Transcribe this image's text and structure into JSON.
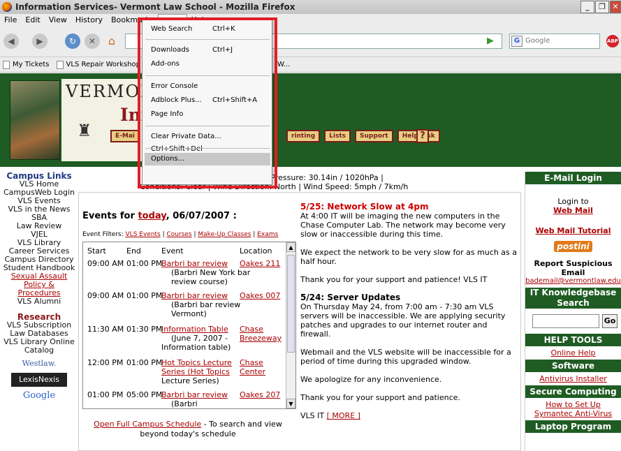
{
  "window": {
    "title": "Information Services- Vermont Law School - Mozilla Firefox"
  },
  "menubar": {
    "items": [
      "File",
      "Edit",
      "View",
      "History",
      "Bookmarks",
      "Tools",
      "Help"
    ]
  },
  "navbar": {
    "search_placeholder": "Google",
    "abp": "ABP"
  },
  "bookmarks": [
    "My Tickets",
    "VLS Repair Workshop",
    "W..."
  ],
  "banner": {
    "title": "VERMONT",
    "subtitle": "Inf",
    "buttons": [
      "E-Mai",
      "rinting",
      "Lists",
      "Support",
      "Helpdesk"
    ],
    "help": "?"
  },
  "tools_menu": {
    "web_search": "Web Search",
    "web_search_sc": "Ctrl+K",
    "downloads": "Downloads",
    "downloads_sc": "Ctrl+J",
    "addons": "Add-ons",
    "error_console": "Error Console",
    "adblock": "Adblock Plus...",
    "adblock_sc": "Ctrl+Shift+A",
    "page_info": "Page Info",
    "clear_private": "Clear Private Data... Ctrl+Shift+Del",
    "options": "Options..."
  },
  "left_nav": {
    "campus_head": "Campus Links",
    "campus_links": [
      "VLS Home",
      "CampusWeb Login",
      "VLS Events",
      "VLS in the News",
      "SBA",
      "Law Review",
      "VJEL",
      "VLS Library",
      "Career Services",
      "Campus Directory",
      "Student Handbook"
    ],
    "red_links": [
      "Sexual Assault",
      "Policy &",
      "Procedures"
    ],
    "alumni": "VLS Alumni",
    "research_head": "Research",
    "research_links": [
      "VLS Subscription",
      "Law Databases",
      "VLS Library Online",
      "Catalog"
    ],
    "westlaw": "Westlaw.",
    "lexis": "LexisNexis",
    "google": "Google"
  },
  "weather": {
    "line1": "nidity: 53% | Pressure: 30.14in / 1020hPa |",
    "line2": "Conditions: Clear | Wind Direction: North | Wind Speed: 5mph / 7km/h"
  },
  "events": {
    "title_prefix": "Events for",
    "title_link": "today",
    "title_suffix": ", 06/07/2007 :",
    "filters_label": "Event Filters:",
    "filters": [
      "VLS Events",
      "Courses",
      "Make-Up Classes",
      "Exams"
    ],
    "columns": [
      "Start",
      "End",
      "Event",
      "Location"
    ],
    "rows": [
      {
        "start": "09:00 AM",
        "end": "01:00 PM",
        "event": "Barbri bar review",
        "desc1": "(Barbri New York bar",
        "desc2": "review course)",
        "loc1": "Oakes 211",
        "loc2": ""
      },
      {
        "start": "09:00 AM",
        "end": "01:00 PM",
        "event": "Barbri bar review",
        "desc1": "(Barbri bar review",
        "desc2": "Vermont)",
        "loc1": "Oakes 007",
        "loc2": ""
      },
      {
        "start": "11:30 AM",
        "end": "01:30 PM",
        "event": "Information Table",
        "desc1": "(June 7, 2007 -",
        "desc2": "Information table)",
        "loc1": "Chase",
        "loc2": "Breezeway"
      },
      {
        "start": "12:00 PM",
        "end": "01:00 PM",
        "event": "Hot Topics Lecture",
        "desc1": "Series (Hot Topics",
        "desc2": "Lecture Series)",
        "loc1": "Chase",
        "loc2": "Center"
      },
      {
        "start": "01:00 PM",
        "end": "05:00 PM",
        "event": "Barbri bar review",
        "desc1": "(Barbri",
        "desc2": "",
        "loc1": "Oakes 207",
        "loc2": ""
      }
    ],
    "full_link": "Open Full Campus Schedule",
    "full_text": " - To search and view beyond today's schedule"
  },
  "news": {
    "h1": "5/25: Network Slow at 4pm",
    "p1": "At 4:00 IT will be imaging the new computers in the Chase Computer Lab. The network may become very slow or inaccessible during this time.",
    "p2": "We expect the network to be very slow for as much as a half hour.",
    "p3": "Thank you for your support and patience! VLS IT",
    "h2": "5/24: Server Updates",
    "p4": "On Thursday May 24, from 7:00 am - 7:30 am VLS servers will be inaccessible. We are applying security patches and upgrades to our internet router and firewall.",
    "p5": "Webmail and the VLS website will be inaccessible for a period of time during this upgraded window.",
    "p6": "We apologize for any inconvenience.",
    "p7": "Thank you for your support and patience.",
    "p8_prefix": "VLS IT",
    "p8_link": "[ MORE ]"
  },
  "right_bar": {
    "email_head": "E-Mail Login",
    "login_to": "Login to",
    "web_mail": "Web Mail",
    "tutorial": "Web Mail Tutorial",
    "postini": "postini",
    "report": "Report Suspicious Email",
    "bademail": "bademail@vermontlaw.edu",
    "kb_head": "IT Knowledgebase Search",
    "go": "Go",
    "help_head": "HELP TOOLS",
    "online_help": "Online Help",
    "software_head": "Software",
    "antivirus": "Antivirus Installer",
    "secure_head": "Secure Computing",
    "symantec": "How to Set Up Symantec Anti-Virus",
    "laptop_head": "Laptop Program"
  }
}
